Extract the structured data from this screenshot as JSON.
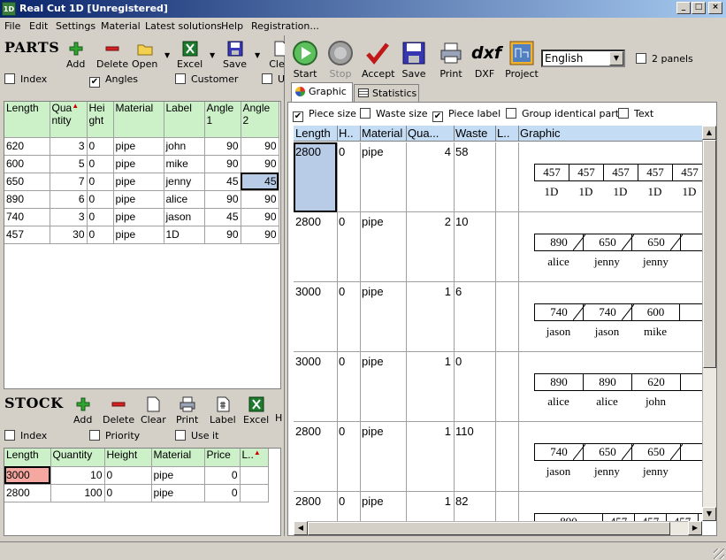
{
  "window": {
    "title": "Real Cut 1D [Unregistered]",
    "icon_text": "1D"
  },
  "menu": [
    "File",
    "Edit",
    "Settings",
    "Material",
    "Latest solutions",
    "Help",
    "Registration..."
  ],
  "parts": {
    "title": "PARTS",
    "toolbar": [
      "Add",
      "Delete",
      "Open",
      "Excel",
      "Save",
      "Cle"
    ],
    "options": [
      {
        "label": "Index",
        "checked": false
      },
      {
        "label": "Angles",
        "checked": true
      },
      {
        "label": "Customer",
        "checked": false
      },
      {
        "label": "U",
        "checked": false
      }
    ],
    "columns": [
      [
        "Length"
      ],
      [
        "Qua",
        "ntity"
      ],
      [
        "Hei",
        "ght"
      ],
      [
        "Material"
      ],
      [
        "Label"
      ],
      [
        "Angle",
        "1"
      ],
      [
        "Angle",
        "2"
      ]
    ],
    "rows": [
      [
        "620",
        "3",
        "0",
        "pipe",
        "john",
        "90",
        "90"
      ],
      [
        "600",
        "5",
        "0",
        "pipe",
        "mike",
        "90",
        "90"
      ],
      [
        "650",
        "7",
        "0",
        "pipe",
        "jenny",
        "45",
        "45"
      ],
      [
        "890",
        "6",
        "0",
        "pipe",
        "alice",
        "90",
        "90"
      ],
      [
        "740",
        "3",
        "0",
        "pipe",
        "jason",
        "45",
        "90"
      ],
      [
        "457",
        "30",
        "0",
        "pipe",
        "1D",
        "90",
        "90"
      ]
    ]
  },
  "stock": {
    "title": "STOCK",
    "toolbar": [
      "Add",
      "Delete",
      "Clear",
      "Print",
      "Label",
      "Excel",
      "H"
    ],
    "options": [
      {
        "label": "Index",
        "checked": false
      },
      {
        "label": "Priority",
        "checked": false
      },
      {
        "label": "Use it",
        "checked": false
      }
    ],
    "columns": [
      "Length",
      "Quantity",
      "Height",
      "Material",
      "Price",
      "L.."
    ],
    "rows": [
      [
        "3000",
        "10",
        "0",
        "pipe",
        "0",
        ""
      ],
      [
        "2800",
        "100",
        "0",
        "pipe",
        "0",
        ""
      ]
    ]
  },
  "main_toolbar": [
    "Start",
    "Stop",
    "Accept",
    "Save",
    "Print",
    "DXF",
    "Project"
  ],
  "dxf_text": "dxf",
  "language": "English",
  "two_panels": {
    "label": "2 panels",
    "checked": false
  },
  "tabs": [
    "Graphic",
    "Statistics"
  ],
  "graphic_options": [
    {
      "label": "Piece size",
      "checked": true
    },
    {
      "label": "Waste size",
      "checked": false
    },
    {
      "label": "Piece label",
      "checked": true
    },
    {
      "label": "Group identical parts",
      "checked": false
    },
    {
      "label": "Text",
      "checked": false
    }
  ],
  "results": {
    "columns": [
      "Length",
      "H..",
      "Material",
      "Qua...",
      "Waste",
      "L..",
      "Graphic"
    ],
    "rows": [
      {
        "length": "2800",
        "height": "0",
        "material": "pipe",
        "qty": "4",
        "waste": "58",
        "pieces": [
          {
            "size": "457",
            "label": "1D",
            "cut": ""
          },
          {
            "size": "457",
            "label": "1D",
            "cut": ""
          },
          {
            "size": "457",
            "label": "1D",
            "cut": ""
          },
          {
            "size": "457",
            "label": "1D",
            "cut": ""
          },
          {
            "size": "457",
            "label": "1D",
            "cut": ""
          }
        ]
      },
      {
        "length": "2800",
        "height": "0",
        "material": "pipe",
        "qty": "2",
        "waste": "10",
        "pieces": [
          {
            "size": "890",
            "label": "alice",
            "cut": "right"
          },
          {
            "size": "650",
            "label": "jenny",
            "cut": "both"
          },
          {
            "size": "650",
            "label": "jenny",
            "cut": "both"
          }
        ]
      },
      {
        "length": "3000",
        "height": "0",
        "material": "pipe",
        "qty": "1",
        "waste": "6",
        "pieces": [
          {
            "size": "740",
            "label": "jason",
            "cut": "right"
          },
          {
            "size": "740",
            "label": "jason",
            "cut": "right"
          },
          {
            "size": "600",
            "label": "mike",
            "cut": ""
          }
        ]
      },
      {
        "length": "3000",
        "height": "0",
        "material": "pipe",
        "qty": "1",
        "waste": "0",
        "pieces": [
          {
            "size": "890",
            "label": "alice",
            "cut": ""
          },
          {
            "size": "890",
            "label": "alice",
            "cut": ""
          },
          {
            "size": "620",
            "label": "john",
            "cut": ""
          }
        ]
      },
      {
        "length": "2800",
        "height": "0",
        "material": "pipe",
        "qty": "1",
        "waste": "110",
        "pieces": [
          {
            "size": "740",
            "label": "jason",
            "cut": "right"
          },
          {
            "size": "650",
            "label": "jenny",
            "cut": "both"
          },
          {
            "size": "650",
            "label": "jenny",
            "cut": "both"
          }
        ]
      },
      {
        "length": "2800",
        "height": "0",
        "material": "pipe",
        "qty": "1",
        "waste": "82",
        "pieces": [
          {
            "size": "890",
            "label": "",
            "cut": ""
          },
          {
            "size": "457",
            "label": "",
            "cut": ""
          },
          {
            "size": "457",
            "label": "",
            "cut": ""
          },
          {
            "size": "457",
            "label": "",
            "cut": ""
          }
        ]
      }
    ]
  },
  "colors": {
    "header_green": "#ccf0c8",
    "header_blue": "#c4dcf4",
    "selected": "#b8cce8",
    "stock_selected": "#f4a8a0"
  }
}
